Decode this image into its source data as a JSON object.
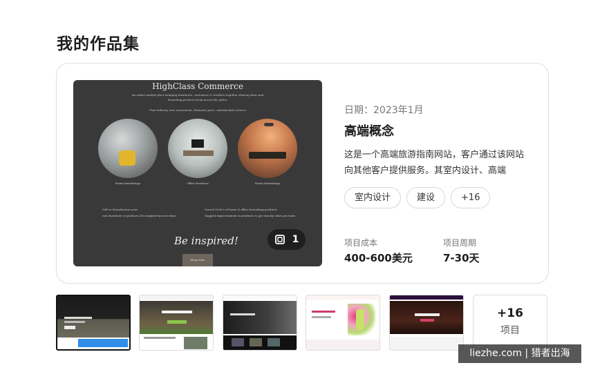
{
  "page": {
    "title": "我的作品集"
  },
  "preview": {
    "site_title": "HighClass Commerce",
    "subtitle": "An online market-place bringing furnitures, customers & resellers together sharing ideas and furnishing products from across the globe.",
    "quote": "\"Fast delivery, free assessment, Fantastic price, unbelievable service\"",
    "captions": [
      "Home furnishings",
      "Office furniture",
      "Home furnishings"
    ],
    "bullets_left": [
      "Sell or Manufacture your",
      "own furniture or products Get inspired by new ideas"
    ],
    "bullets_right": [
      "Search 1000's of home & office furnishing products",
      "Suggest improvements to products to get exactly what you want"
    ],
    "tagline": "Be inspired!",
    "shop_button": "Shop Now",
    "image_count": "1",
    "gallery_icon": "gallery-icon"
  },
  "project": {
    "date": "日期：2023年1月",
    "name": "高端概念",
    "description": "这是一个高端旅游指南网站，客户通过该网站向其他客户提供服务。其室内设计、高端",
    "tags": [
      "室内设计",
      "建设",
      "+16"
    ],
    "cost_label": "项目成本",
    "cost_value": "400-600美元",
    "duration_label": "项目周期",
    "duration_value": "7-30天"
  },
  "thumbnails": {
    "more_count": "+16",
    "more_label": "项目"
  },
  "watermark": "liezhe.com | 猎者出海"
}
